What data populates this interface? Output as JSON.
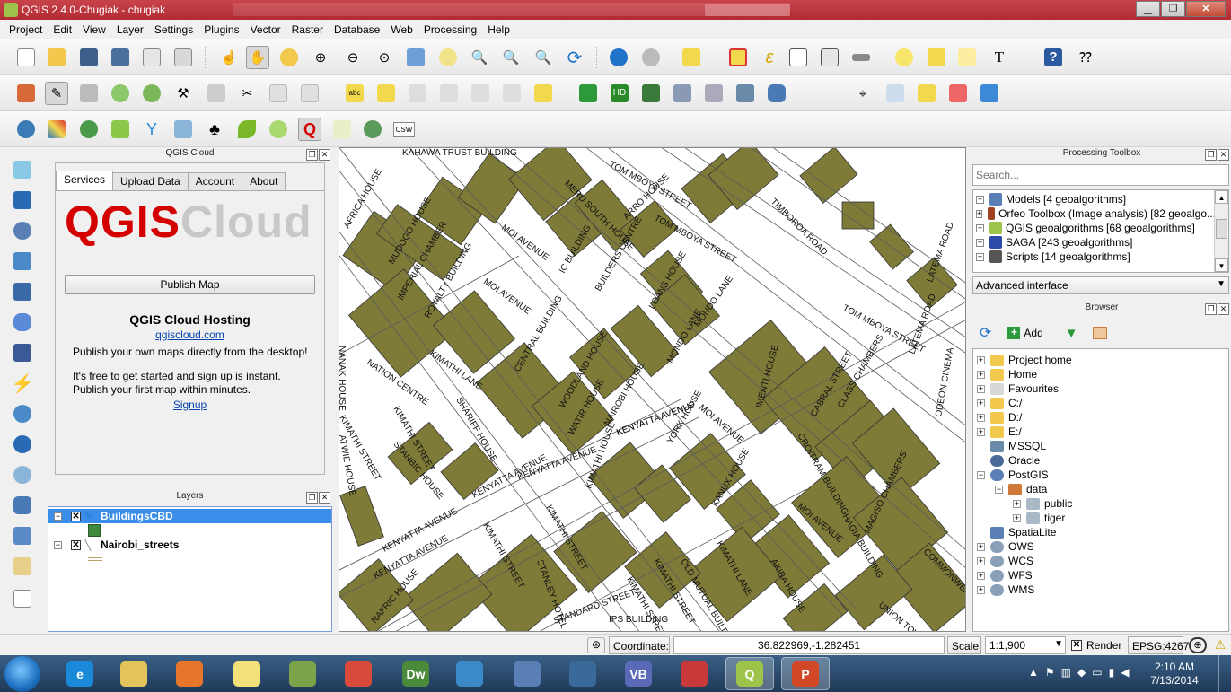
{
  "window": {
    "title": "QGIS 2.4.0-Chugiak - chugiak",
    "minimize": "▁",
    "maximize": "❐",
    "close": "✕"
  },
  "menu": [
    "Project",
    "Edit",
    "View",
    "Layer",
    "Settings",
    "Plugins",
    "Vector",
    "Raster",
    "Database",
    "Web",
    "Processing",
    "Help"
  ],
  "toolbar": {
    "csw_label": "CSW",
    "text_tool": "T"
  },
  "qgis_cloud": {
    "dock_title": "QGIS Cloud",
    "tabs": [
      "Services",
      "Upload Data",
      "Account",
      "About"
    ],
    "logo_qgis": "QGIS",
    "logo_cloud": "Cloud",
    "publish_button": "Publish Map",
    "hosting_title": "QGIS Cloud Hosting",
    "hosting_link": "qgiscloud.com",
    "desc1": "Publish your own maps directly from the desktop!",
    "desc2": "It's free to get started and sign up is instant. Publish your first map within minutes.",
    "signup": "Signup"
  },
  "layers": {
    "dock_title": "Layers",
    "items": [
      {
        "name": "BuildingsCBD",
        "checked": "✕",
        "color": "#3f8a3a"
      },
      {
        "name": "Nairobi_streets",
        "checked": "✕",
        "color": "#b9a26a"
      }
    ]
  },
  "map": {
    "street_labels": [
      "KAHAWA TRUST BUILDING",
      "TOM MBOYA STREET",
      "TOM MBOYA STREET",
      "TOM MBOYA STREET",
      "TIMBOROA ROAD",
      "LATEMA ROAD",
      "AFRICA HOUSE",
      "MUDOGO HOUSE",
      "IMPERIAL CHAMBER",
      "ROYALTY BUILDING",
      "MERU SOUTH HOUSE",
      "MOI AVENUE",
      "MOI AVENUE",
      "KIMATHI LANE",
      "IC BUILDING",
      "BUILDERS CENTRE",
      "ARRO HOUSE",
      "MONDO LANE",
      "LOANS HOUSE",
      "MONDO LANE",
      "NATION CENTRE",
      "CENTRAL BUILDING",
      "WOODLAND HOUSE",
      "SHARIFF HOUSE",
      "WATIR HOUSE",
      "NAIROBI HOUSE",
      "IMENTI HOUSE",
      "CABRAL STREET",
      "CLASS CHAMBERS",
      "LATEMA ROAD",
      "ODEON CINEMA",
      "KIMATHI STREET",
      "KIMATHI STREET",
      "NANAK HOUSE",
      "ATWIE HOUSE",
      "STANBIC HOUSE",
      "KENYATTA AVENUE",
      "KENYATTA AVENUE",
      "KENYATTA AVENUE",
      "KENYATTA AVENUE",
      "KENYATTA AVENUE",
      "KENYATTA AVENUE",
      "YORK HOUSE",
      "KIMATHI HOUSE",
      "MOI AVENUE",
      "MOI AVENUE",
      "CROITRAM BUILDING",
      "HAGIA BUILDING",
      "MAGISO CHAMBERS",
      "COMMONWEALTH",
      "KIMATHI STREET",
      "KIMATHI STREET",
      "KIMATHI STREET",
      "KANUX HOUSE",
      "KIMATHI LANE",
      "AKIBA HOUSE",
      "OLD MUTUAL BUILDING",
      "UNION TOWERS",
      "STANLEY HOTEL",
      "NAFRIC HOUSE",
      "STANDARD STREET",
      "IPS BUILDING",
      "KIMATHI STREET"
    ]
  },
  "processing": {
    "dock_title": "Processing Toolbox",
    "search_placeholder": "Search...",
    "items": [
      {
        "label": "Models [4 geoalgorithms]",
        "color": "#5a7fb5"
      },
      {
        "label": "Orfeo Toolbox (Image analysis) [82 geoalgo...",
        "color": "#a04020"
      },
      {
        "label": "QGIS geoalgorithms [68 geoalgorithms]",
        "color": "#9ec34a"
      },
      {
        "label": "SAGA [243 geoalgorithms]",
        "color": "#2c4aa8"
      },
      {
        "label": "Scripts [14 geoalgorithms]",
        "color": "#555555"
      }
    ],
    "interface_mode": "Advanced interface"
  },
  "browser": {
    "dock_title": "Browser",
    "add_label": "Add",
    "items": [
      {
        "label": "Project home",
        "indent": 0,
        "expander": "+",
        "icon": "folder"
      },
      {
        "label": "Home",
        "indent": 0,
        "expander": "+",
        "icon": "folder"
      },
      {
        "label": "Favourites",
        "indent": 0,
        "expander": "+",
        "icon": "star"
      },
      {
        "label": "C:/",
        "indent": 0,
        "expander": "+",
        "icon": "folder"
      },
      {
        "label": "D:/",
        "indent": 0,
        "expander": "+",
        "icon": "folder"
      },
      {
        "label": "E:/",
        "indent": 0,
        "expander": "+",
        "icon": "folder"
      },
      {
        "label": "MSSQL",
        "indent": 0,
        "expander": "",
        "icon": "db"
      },
      {
        "label": "Oracle",
        "indent": 0,
        "expander": "",
        "icon": "oracle"
      },
      {
        "label": "PostGIS",
        "indent": 0,
        "expander": "−",
        "icon": "postgis"
      },
      {
        "label": "data",
        "indent": 1,
        "expander": "−",
        "icon": "conn"
      },
      {
        "label": "public",
        "indent": 2,
        "expander": "+",
        "icon": "schema"
      },
      {
        "label": "tiger",
        "indent": 2,
        "expander": "+",
        "icon": "schema"
      },
      {
        "label": "SpatiaLite",
        "indent": 0,
        "expander": "",
        "icon": "feather"
      },
      {
        "label": "OWS",
        "indent": 0,
        "expander": "+",
        "icon": "globe"
      },
      {
        "label": "WCS",
        "indent": 0,
        "expander": "+",
        "icon": "globe"
      },
      {
        "label": "WFS",
        "indent": 0,
        "expander": "+",
        "icon": "globe"
      },
      {
        "label": "WMS",
        "indent": 0,
        "expander": "+",
        "icon": "globe"
      }
    ]
  },
  "status": {
    "coordinate_label": "Coordinate:",
    "coordinate_value": "36.822969,-1.282451",
    "scale_label": "Scale",
    "scale_value": "1:1,900",
    "render_label": "Render",
    "render_checked": "✕",
    "crs": "EPSG:4267"
  },
  "taskbar": {
    "time": "2:10 AM",
    "date": "7/13/2014",
    "apps": [
      {
        "name": "internet-explorer",
        "glyph": "e",
        "color": "#1a8ad8"
      },
      {
        "name": "file-explorer",
        "glyph": "",
        "color": "#e3c45a"
      },
      {
        "name": "firefox",
        "glyph": "",
        "color": "#e8762a"
      },
      {
        "name": "sticky-notes",
        "glyph": "",
        "color": "#f3e27a"
      },
      {
        "name": "file-manager",
        "glyph": "",
        "color": "#7ba34a"
      },
      {
        "name": "chrome",
        "glyph": "",
        "color": "#d84a3a"
      },
      {
        "name": "dreamweaver",
        "glyph": "Dw",
        "color": "#4a8a3a"
      },
      {
        "name": "search-app",
        "glyph": "",
        "color": "#3a8ac8"
      },
      {
        "name": "postgresql",
        "glyph": "",
        "color": "#5a7fb5"
      },
      {
        "name": "globe-app",
        "glyph": "",
        "color": "#3a6a9a"
      },
      {
        "name": "visual-basic",
        "glyph": "VB",
        "color": "#5a6ab8"
      },
      {
        "name": "pdf-app",
        "glyph": "",
        "color": "#c83a3a"
      },
      {
        "name": "qgis",
        "glyph": "Q",
        "color": "#9ec34a"
      },
      {
        "name": "powerpoint",
        "glyph": "P",
        "color": "#d24726"
      }
    ]
  }
}
